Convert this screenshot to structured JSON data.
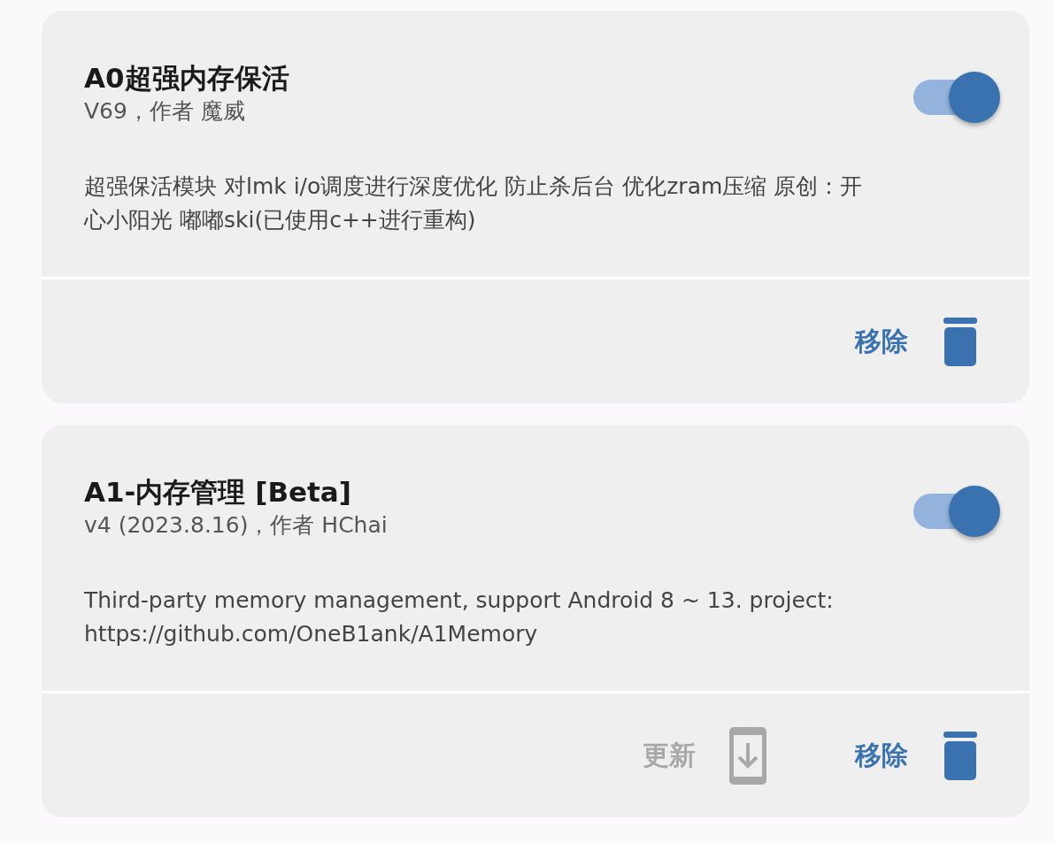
{
  "modules": [
    {
      "title": "A0超强内存保活",
      "version": "V69，作者 魔威",
      "description": "超强保活模块 对lmk i/o调度进行深度优化 防止杀后台 优化zram压缩 原创：开心小阳光 嘟嘟ski(已使用c++进行重构)",
      "enabled": true,
      "actions": [
        {
          "kind": "remove",
          "label": "移除",
          "disabled": false
        }
      ]
    },
    {
      "title": "A1-内存管理 [Beta]",
      "version": "v4 (2023.8.16)，作者 HChai",
      "description": "Third-party memory management, support Android 8 ~ 13. project: https://github.com/OneB1ank/A1Memory",
      "enabled": true,
      "actions": [
        {
          "kind": "update",
          "label": "更新",
          "disabled": true
        },
        {
          "kind": "remove",
          "label": "移除",
          "disabled": false
        }
      ]
    }
  ]
}
